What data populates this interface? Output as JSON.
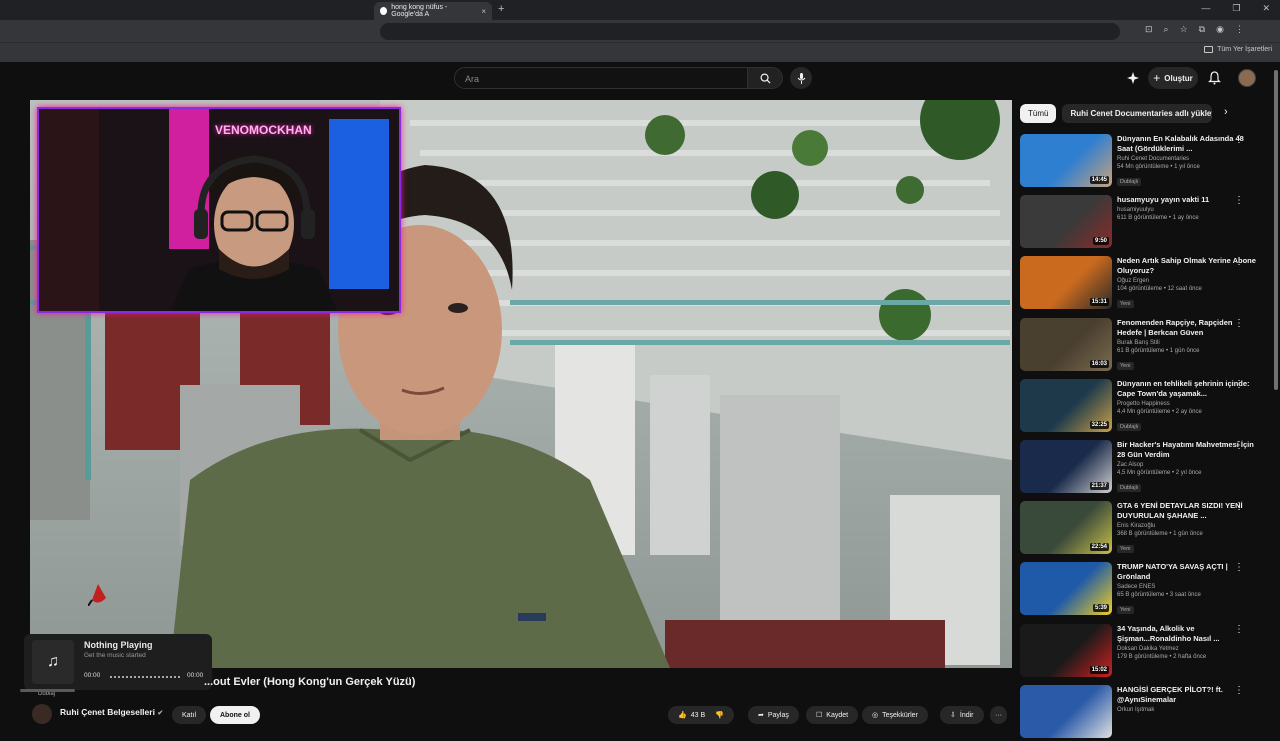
{
  "browser": {
    "tab_title": "hong kong nüfus - Google'da A",
    "tab_close": "×",
    "new_tab": "+",
    "window_controls": [
      "—",
      "❐",
      "✕"
    ],
    "bookmarks_folder": "Tüm Yer İşaretleri"
  },
  "header": {
    "search_placeholder": "Ara",
    "create_label": "Oluştur"
  },
  "webcam": {
    "overlay_text": "VENOMOCKHAN"
  },
  "music": {
    "status": "Nothing Playing",
    "sub": "Get the music started",
    "time_start": "00:00",
    "time_end": "00:00"
  },
  "video": {
    "title": "...out Evler (Hong Kong'un Gerçek Yüzü)",
    "dub_label": "Dublaj",
    "channel": "Ruhi Çenet Belgeselleri",
    "join_label": "Katıl",
    "subscribe_label": "Abone ol",
    "likes": "43 B",
    "share_label": "Paylaş",
    "save_label": "Kaydet",
    "thanks_label": "Teşekkürler",
    "download_label": "İndir",
    "more_label": "···"
  },
  "sidebar": {
    "chips": [
      "Tümü",
      "Ruhi Cenet Documentaries adlı yükleyiciden"
    ],
    "items": [
      {
        "title": "Dünyanın En Kalabalık Adasında 48 Saat (Gördüklerimi ...",
        "channel": "Ruhi Cenet Documentaries",
        "meta": "54 Mn görüntüleme • 1 yıl önce",
        "badge": "Dublajlı",
        "duration": "14:45",
        "c1": "#2f7fd1",
        "c2": "#c9a27a"
      },
      {
        "title": "husamyuyu yayın vakti 11",
        "channel": "husamiyuulyu",
        "meta": "611 B görüntüleme • 1 ay önce",
        "badge": "",
        "duration": "9:50",
        "c1": "#3a3a3a",
        "c2": "#8b2a2a"
      },
      {
        "title": "Neden Artık Sahip Olmak Yerine Abone Oluyoruz?",
        "channel": "Oğuz Ergen",
        "meta": "104 görüntüleme • 12 saat önce",
        "badge": "Yeni",
        "duration": "15:31",
        "c1": "#c96a1e",
        "c2": "#2a2a2a"
      },
      {
        "title": "Fenomenden Rapçiye, Rapçiden Hedefe | Berkcan Güven",
        "channel": "Burak Barış Stili",
        "meta": "61 B görüntüleme • 1 gün önce",
        "badge": "Yeni",
        "duration": "16:03",
        "c1": "#4a4030",
        "c2": "#7a6a50"
      },
      {
        "title": "Dünyanın en tehlikeli şehrinin içinde: Cape Town'da yaşamak...",
        "channel": "Progetto Happiness",
        "meta": "4,4 Mn görüntüleme • 2 ay önce",
        "badge": "Dublajlı",
        "duration": "32:25",
        "c1": "#1e3a4a",
        "c2": "#c9a04a"
      },
      {
        "title": "Bir Hacker's Hayatımı Mahvetmesi İçin 28 Gün Verdim",
        "channel": "Zac Alsop",
        "meta": "4,5 Mn görüntüleme • 2 yıl önce",
        "badge": "Dublajlı",
        "duration": "21:37",
        "c1": "#1a2a4a",
        "c2": "#d0d0d0"
      },
      {
        "title": "GTA 6 YENİ DETAYLAR SIZDI! YENİ DUYURULAN ŞAHANE ...",
        "channel": "Enis Kirazoğlu",
        "meta": "368 B görüntüleme • 1 gün önce",
        "badge": "Yeni",
        "duration": "22:54",
        "c1": "#3a4a3a",
        "c2": "#c9c04a"
      },
      {
        "title": "TRUMP NATO'YA SAVAŞ AÇTI | Grönland",
        "channel": "Sadece ENES",
        "meta": "65 B görüntüleme • 3 saat önce",
        "badge": "Yeni",
        "duration": "5:39",
        "c1": "#1e5aa8",
        "c2": "#f2d020"
      },
      {
        "title": "34 Yaşında, Alkolik ve Şişman...Ronaldinho Nasıl ...",
        "channel": "Doksan Dakika Yetmez",
        "meta": "179 B görüntüleme • 2 hafta önce",
        "badge": "",
        "duration": "15:02",
        "c1": "#1a1a1a",
        "c2": "#d02020"
      },
      {
        "title": "HANGİSİ GERÇEK PİLOT?! ft. @AynıSinemalar",
        "channel": "Orkun Işıtmak",
        "meta": "",
        "badge": "",
        "duration": "",
        "c1": "#2a5aa8",
        "c2": "#e0e0e0"
      }
    ]
  }
}
